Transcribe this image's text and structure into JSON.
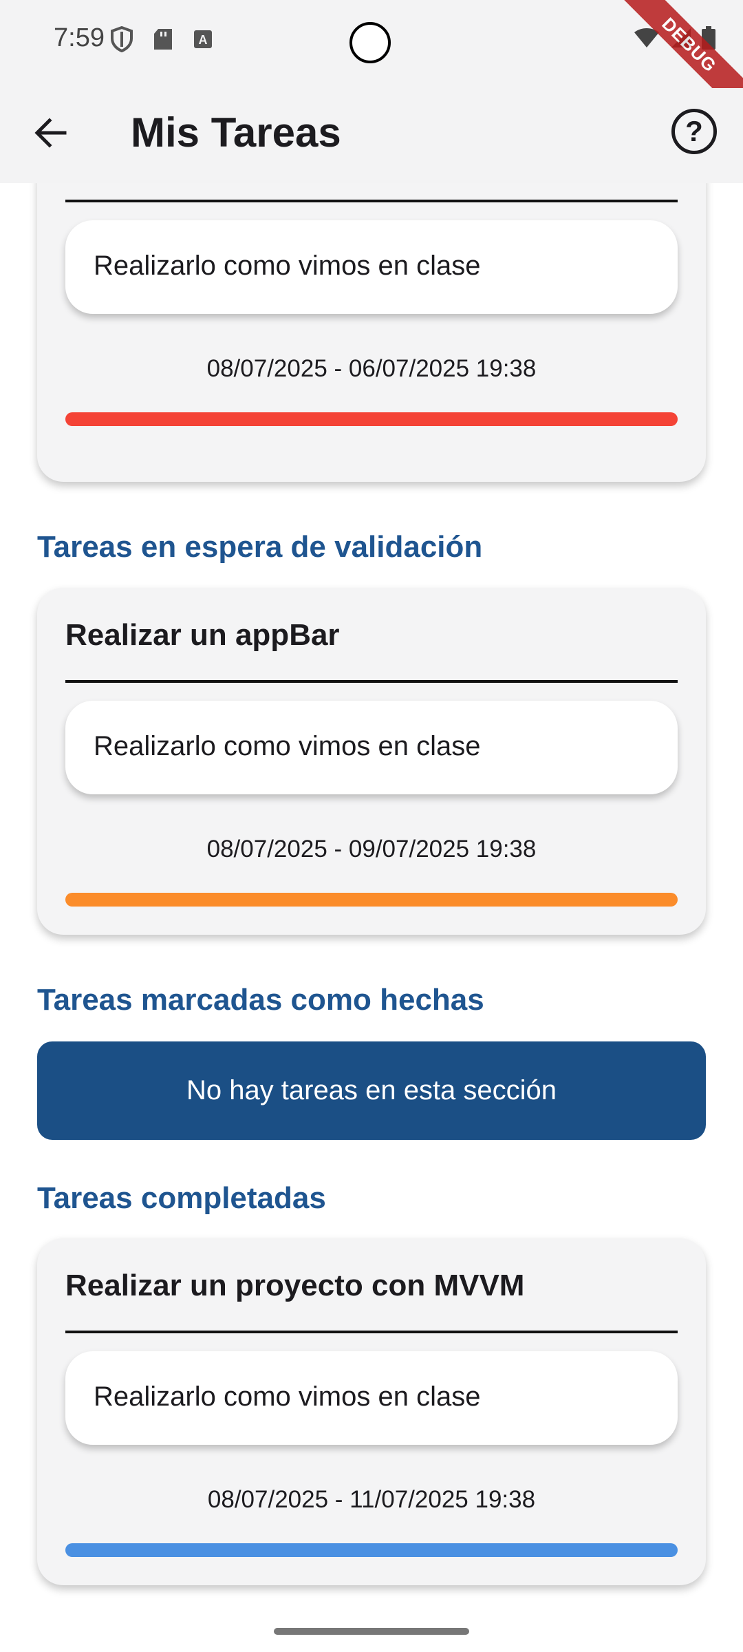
{
  "status_bar": {
    "time": "7:59",
    "icons_left": [
      "shield-icon",
      "sd-card-icon",
      "keyboard-a-icon"
    ],
    "icons_right": [
      "wifi-icon",
      "signal-icon",
      "battery-icon"
    ],
    "debug_ribbon": "DEBUG"
  },
  "app_bar": {
    "title": "Mis Tareas",
    "help_label": "?"
  },
  "colors": {
    "accent": "#1f5590",
    "banner": "#1b4f85",
    "overdue": "#f44336",
    "pending": "#fb8c2a",
    "completed": "#4a90e2"
  },
  "partial_card": {
    "description": "Realizarlo como vimos en clase",
    "dates": "08/07/2025 - 06/07/2025 19:38"
  },
  "sections": [
    {
      "header": "Tareas en espera de validación",
      "task": {
        "title": "Realizar un appBar",
        "description": "Realizarlo como vimos en clase",
        "dates": "08/07/2025 - 09/07/2025 19:38"
      }
    },
    {
      "header": "Tareas marcadas como hechas",
      "empty_message": "No hay tareas en esta sección"
    },
    {
      "header": "Tareas completadas",
      "task": {
        "title": "Realizar un proyecto con MVVM",
        "description": "Realizarlo como vimos en clase",
        "dates": "08/07/2025 - 11/07/2025 19:38"
      }
    }
  ]
}
